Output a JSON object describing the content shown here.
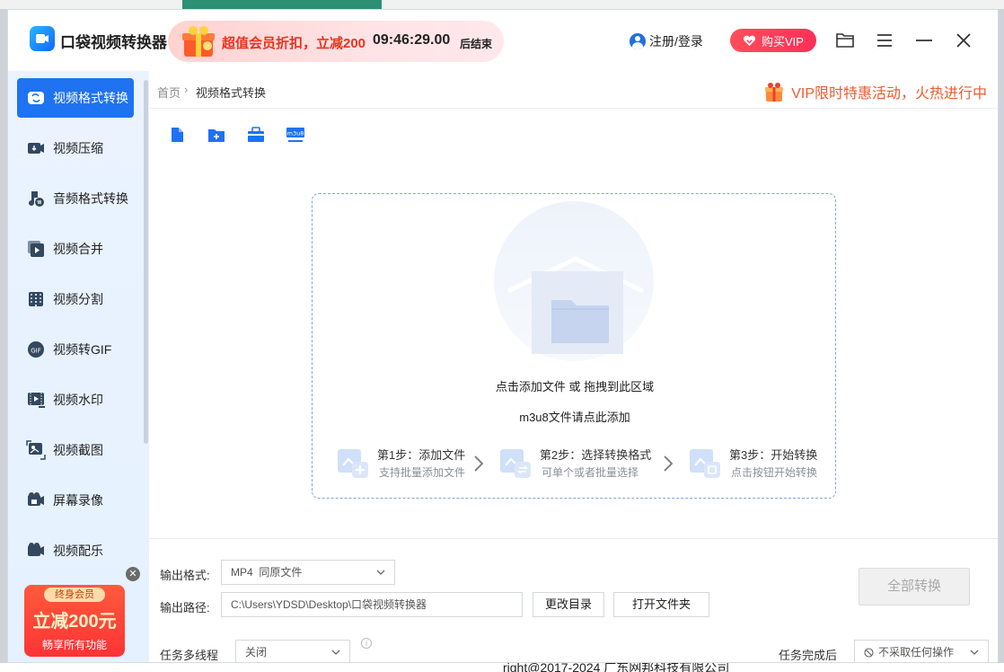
{
  "app": {
    "title": "口袋视频转换器"
  },
  "promo": {
    "text": "超值会员折扣，立减200",
    "countdown": "09:46:29.00",
    "end_label": "后结束"
  },
  "header": {
    "login_label": "注册/登录",
    "vip_label": "购买VIP"
  },
  "sidebar": {
    "items": [
      {
        "label": "视频格式转换",
        "active": true
      },
      {
        "label": "视频压缩"
      },
      {
        "label": "音频格式转换"
      },
      {
        "label": "视频合并"
      },
      {
        "label": "视频分割"
      },
      {
        "label": "视频转GIF"
      },
      {
        "label": "视频水印"
      },
      {
        "label": "视频截图"
      },
      {
        "label": "屏幕录像"
      },
      {
        "label": "视频配乐"
      }
    ],
    "vip_card": {
      "tag": "终身会员",
      "headline": "立减200元",
      "sub": "畅享所有功能"
    }
  },
  "breadcrumb": {
    "home": "首页",
    "current": "视频格式转换"
  },
  "activity_banner": "VIP限时特惠活动，火热进行中",
  "toolbar": {
    "m3u8_label": "m3u8"
  },
  "dropzone": {
    "line1": "点击添加文件 或 拖拽到此区域",
    "line2": "m3u8文件请点此添加",
    "steps": [
      {
        "title": "第1步：添加文件",
        "sub": "支持批量添加文件"
      },
      {
        "title": "第2步：选择转换格式",
        "sub": "可单个或者批量选择"
      },
      {
        "title": "第3步：开始转换",
        "sub": "点击按钮开始转换"
      }
    ]
  },
  "output": {
    "format_label": "输出格式:",
    "format_value": "MP4  同原文件",
    "path_label": "输出路径:",
    "path_value": "C:\\Users\\YDSD\\Desktop\\口袋视频转换器",
    "change_dir_label": "更改目录",
    "open_folder_label": "打开文件夹",
    "convert_all_label": "全部转换",
    "multithread_label": "任务多线程",
    "multithread_value": "关闭",
    "after_label": "任务完成后",
    "after_value": "不采取任何操作"
  },
  "background": {
    "copyright": "right@2017-2024 广东网邦科技有限公司"
  },
  "colors": {
    "accent": "#1f72f2",
    "promo_red": "#e8331f",
    "activity_orange": "#ef5a2d"
  }
}
